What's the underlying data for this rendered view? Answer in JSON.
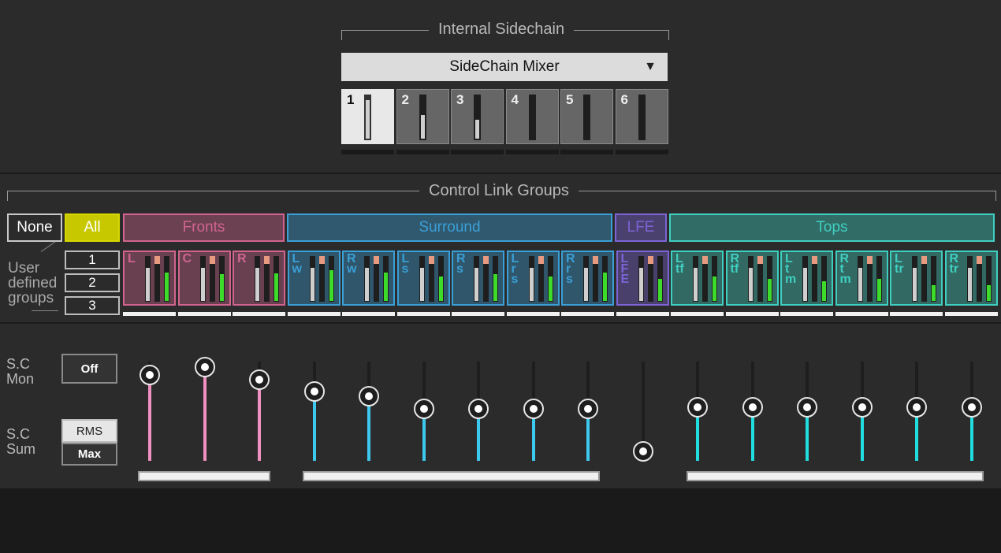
{
  "internal_sidechain": {
    "title": "Internal Sidechain",
    "dropdown_value": "SideChain Mixer",
    "tiles": [
      {
        "label": "1",
        "active": true,
        "level": 0.9
      },
      {
        "label": "2",
        "active": false,
        "level": 0.55
      },
      {
        "label": "3",
        "active": false,
        "level": 0.45
      },
      {
        "label": "4",
        "active": false,
        "level": 0
      },
      {
        "label": "5",
        "active": false,
        "level": 0
      },
      {
        "label": "6",
        "active": false,
        "level": 0
      }
    ]
  },
  "control_link_groups": {
    "title": "Control Link Groups",
    "none_label": "None",
    "all_label": "All",
    "groups": [
      {
        "label": "Fronts",
        "color": "#d0648e"
      },
      {
        "label": "Surround",
        "color": "#3a9fd6"
      },
      {
        "label": "LFE",
        "color": "#7c64d6"
      },
      {
        "label": "Tops",
        "color": "#3fcfc0"
      }
    ],
    "user_defined_label": [
      "User",
      "defined",
      "groups"
    ],
    "user_groups": [
      "1",
      "2",
      "3"
    ],
    "channels": [
      {
        "label": "L",
        "group": 0,
        "level": 0.65
      },
      {
        "label": "C",
        "group": 0,
        "level": 0.6
      },
      {
        "label": "R",
        "group": 0,
        "level": 0.62
      },
      {
        "label": "Lw",
        "group": 1,
        "level": 0.7
      },
      {
        "label": "Rw",
        "group": 1,
        "level": 0.65
      },
      {
        "label": "Ls",
        "group": 1,
        "level": 0.55
      },
      {
        "label": "Rs",
        "group": 1,
        "level": 0.6
      },
      {
        "label": "Lrs",
        "group": 1,
        "level": 0.55
      },
      {
        "label": "Rrs",
        "group": 1,
        "level": 0.65
      },
      {
        "label": "LFE",
        "group": 2,
        "level": 0.5
      },
      {
        "label": "Ltf",
        "group": 3,
        "level": 0.55
      },
      {
        "label": "Rtf",
        "group": 3,
        "level": 0.5
      },
      {
        "label": "Ltm",
        "group": 3,
        "level": 0.45
      },
      {
        "label": "Rtm",
        "group": 3,
        "level": 0.5
      },
      {
        "label": "Ltr",
        "group": 3,
        "level": 0.35
      },
      {
        "label": "Rtr",
        "group": 3,
        "level": 0.35
      }
    ]
  },
  "sidechain_mix": {
    "mon_label": [
      "S.C",
      "Mon"
    ],
    "mon_button": "Off",
    "sum_label": [
      "S.C",
      "Sum"
    ],
    "sum_options": [
      "RMS",
      "Max"
    ],
    "sum_selected": "RMS",
    "fader_levels": [
      0.86,
      0.94,
      0.81,
      0.68,
      0.63,
      0.5,
      0.5,
      0.5,
      0.5,
      0.05,
      0.52,
      0.52,
      0.52,
      0.52,
      0.52,
      0.52
    ]
  }
}
